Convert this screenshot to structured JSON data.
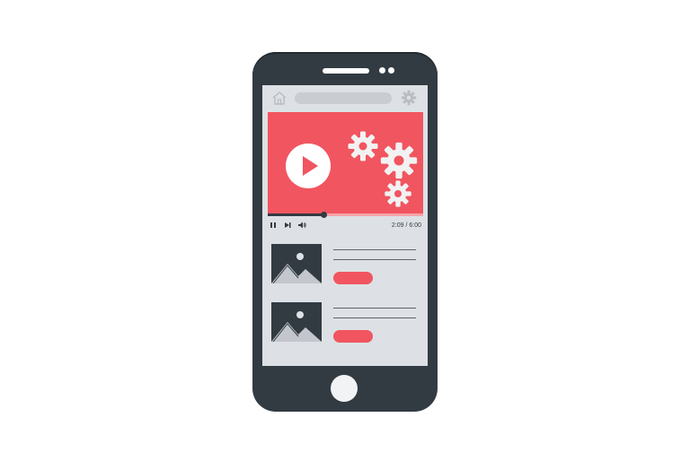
{
  "player": {
    "time_label": "2:09 / 6:00",
    "progress_fraction": 0.358
  },
  "colors": {
    "phone_body": "#323b42",
    "screen_bg": "#dde1e5",
    "accent": "#f15560",
    "gear": "#f2f2f2"
  },
  "icons": {
    "home": "home-icon",
    "settings": "gear-icon",
    "play": "play-icon",
    "pause": "pause-icon",
    "skip": "skip-forward-icon",
    "volume": "volume-icon",
    "image": "image-icon"
  },
  "list": {
    "items": [
      {
        "thumbnail": "image-icon",
        "button": "pill-button"
      },
      {
        "thumbnail": "image-icon",
        "button": "pill-button"
      }
    ]
  }
}
